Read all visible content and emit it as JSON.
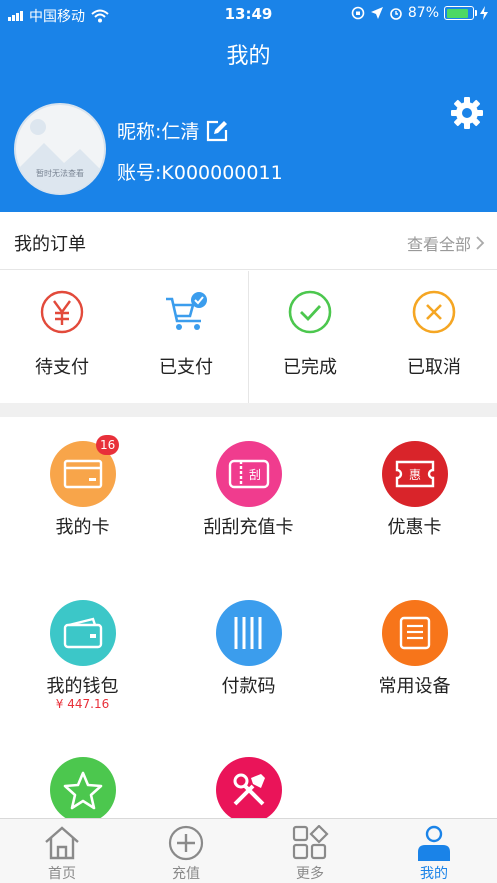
{
  "status_bar": {
    "carrier": "中国移动",
    "time": "13:49",
    "battery": "87%"
  },
  "header": {
    "title": "我的"
  },
  "profile": {
    "avatar_caption": "暂时无法查看",
    "nickname": "昵称:仁清",
    "account": "账号:K000000011"
  },
  "orders": {
    "title": "我的订单",
    "view_all": "查看全部",
    "items": [
      {
        "label": "待支付",
        "icon": "yen-icon"
      },
      {
        "label": "已支付",
        "icon": "cart-check-icon"
      },
      {
        "label": "已完成",
        "icon": "check-circle-icon"
      },
      {
        "label": "已取消",
        "icon": "x-circle-icon"
      }
    ]
  },
  "grid": [
    {
      "label": "我的卡",
      "badge": "16",
      "color": "#f8a54a",
      "icon": "card-icon"
    },
    {
      "label": "刮刮充值卡",
      "color": "#f03c8e",
      "icon": "scratch-card-icon",
      "icon_text": "刮"
    },
    {
      "label": "优惠卡",
      "color": "#d9242a",
      "icon": "coupon-icon",
      "icon_text": "惠"
    },
    {
      "label": "我的钱包",
      "sub": "¥ 447.16",
      "color": "#3cc7c8",
      "icon": "wallet-icon"
    },
    {
      "label": "付款码",
      "color": "#3b9ded",
      "icon": "barcode-icon"
    },
    {
      "label": "常用设备",
      "color": "#f7751a",
      "icon": "device-list-icon"
    },
    {
      "label": "",
      "color": "#4cc74e",
      "icon": "star-icon"
    },
    {
      "label": "",
      "color": "#ea1459",
      "icon": "tools-icon"
    }
  ],
  "tabs": [
    {
      "label": "首页",
      "icon": "home-icon"
    },
    {
      "label": "充值",
      "icon": "plus-circle-icon"
    },
    {
      "label": "更多",
      "icon": "more-grid-icon"
    },
    {
      "label": "我的",
      "icon": "user-icon",
      "active": true
    }
  ],
  "colors": {
    "brand": "#1a83e8",
    "badge": "#e8303a",
    "tab_inactive": "#8a8a8a"
  }
}
